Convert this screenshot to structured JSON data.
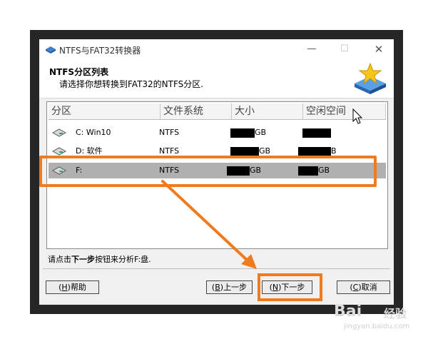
{
  "window": {
    "title": "NTFS与FAT32转换器",
    "minimize": "—",
    "maximize": "☐",
    "close": "✕"
  },
  "header": {
    "title": "NTFS分区列表",
    "subtitle": "请选择你想转换到FAT32的NTFS分区."
  },
  "list": {
    "columns": [
      "分区",
      "文件系统",
      "大小",
      "空闲空间"
    ],
    "rows": [
      {
        "partition": "C: Win10",
        "filesystem": "NTFS",
        "size_visible": "GB",
        "free_visible": "",
        "selected": false
      },
      {
        "partition": "D: 软件",
        "filesystem": "NTFS",
        "size_visible": "GB",
        "free_visible": "B",
        "selected": false
      },
      {
        "partition": "F:",
        "filesystem": "NTFS",
        "size_visible": "GB",
        "free_visible": "GB",
        "selected": true
      }
    ]
  },
  "status": {
    "prefix": "请点击",
    "bold": "下一步",
    "suffix": "按钮来分析F:盘."
  },
  "buttons": {
    "help": {
      "mnemonic": "H",
      "label": "帮助"
    },
    "prev": {
      "mnemonic": "B",
      "label": "上一步"
    },
    "next": {
      "mnemonic": "N",
      "label": "下一步"
    },
    "cancel": {
      "mnemonic": "C",
      "label": "取消"
    }
  },
  "watermark": {
    "logo": "Bai",
    "cn": "经验",
    "url": "jingyan.baidu.com"
  },
  "colors": {
    "highlight": "#f07b1e",
    "selected_row": "#b0b0b0",
    "frame": "#262626"
  }
}
